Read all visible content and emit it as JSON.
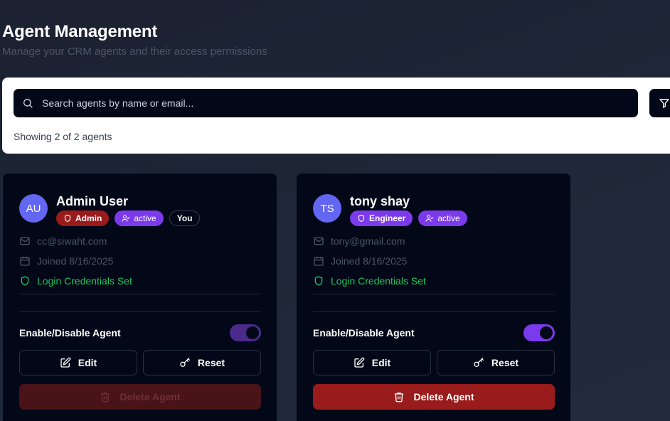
{
  "header": {
    "title": "Agent Management",
    "subtitle": "Manage your CRM agents and their access permissions"
  },
  "search": {
    "placeholder": "Search agents by name or email...",
    "value": "",
    "showing": "Showing 2 of 2 agents"
  },
  "agents": [
    {
      "initials": "AU",
      "name": "Admin User",
      "role": "Admin",
      "status": "active",
      "you_label": "You",
      "email": "cc@siwaht.com",
      "joined": "Joined 8/16/2025",
      "credentials": "Login Credentials Set",
      "toggle_label": "Enable/Disable Agent",
      "enabled": true,
      "edit_label": "Edit",
      "reset_label": "Reset",
      "delete_label": "Delete Agent",
      "delete_disabled": true
    },
    {
      "initials": "TS",
      "name": "tony shay",
      "role": "Engineer",
      "status": "active",
      "email": "tony@gmail.com",
      "joined": "Joined 8/16/2025",
      "credentials": "Login Credentials Set",
      "toggle_label": "Enable/Disable Agent",
      "enabled": true,
      "edit_label": "Edit",
      "reset_label": "Reset",
      "delete_label": "Delete Agent",
      "delete_disabled": false
    }
  ],
  "colors": {
    "accent": "#7c3aed",
    "danger": "#991b1b",
    "success": "#22c55e",
    "avatar": "#6366f1"
  },
  "icons": [
    "search-icon",
    "filter-icon",
    "shield-icon",
    "user-check-icon",
    "mail-icon",
    "calendar-icon",
    "edit-icon",
    "key-icon",
    "trash-icon"
  ]
}
